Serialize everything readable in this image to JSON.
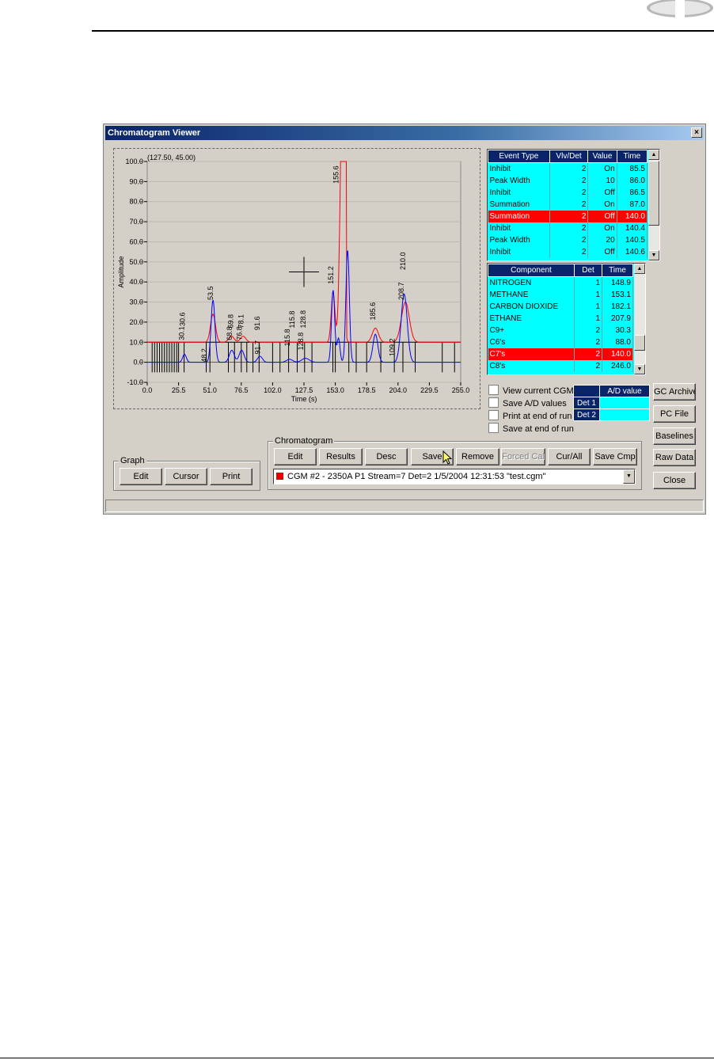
{
  "window": {
    "title": "Chromatogram Viewer",
    "close_glyph": "×"
  },
  "graph": {
    "cursor_readout": "(127.50, 45.00)",
    "xlabel": "Time (s)",
    "ylabel": "Amplitude",
    "y_ticks": [
      "100.0",
      "90.0",
      "80.0",
      "70.0",
      "60.0",
      "50.0",
      "40.0",
      "30.0",
      "20.0",
      "10.0",
      "0.0",
      "-10.0"
    ],
    "x_ticks": [
      "0.0",
      "25.5",
      "51.0",
      "76.5",
      "102.0",
      "127.5",
      "153.0",
      "178.5",
      "204.0",
      "229.5",
      "255.0"
    ],
    "peak_labels": [
      {
        "label": "53.5",
        "x": 53.5,
        "y": 31
      },
      {
        "label": "30.1",
        "x": 30.1,
        "y": 11
      },
      {
        "label": "30.6",
        "x": 30.6,
        "y": 18
      },
      {
        "label": "48.2",
        "x": 48.2,
        "y": 0
      },
      {
        "label": "68.8",
        "x": 68.8,
        "y": 11
      },
      {
        "label": "69.8",
        "x": 69.8,
        "y": 17
      },
      {
        "label": "76.8",
        "x": 76.8,
        "y": 11
      },
      {
        "label": "78.1",
        "x": 78.1,
        "y": 17
      },
      {
        "label": "91.7",
        "x": 91.7,
        "y": 4
      },
      {
        "label": "91.6",
        "x": 91.6,
        "y": 16
      },
      {
        "label": "115.8",
        "x": 115.8,
        "y": 8
      },
      {
        "label": "115.8",
        "x": 119.8,
        "y": 17
      },
      {
        "label": "128.8",
        "x": 128.8,
        "y": 17
      },
      {
        "label": "128.8",
        "x": 126.8,
        "y": 6
      },
      {
        "label": "151.2",
        "x": 151.2,
        "y": 39
      },
      {
        "label": "155.6",
        "x": 155.6,
        "y": 89
      },
      {
        "label": "185.6",
        "x": 185.6,
        "y": 21
      },
      {
        "label": "109.2",
        "x": 201.2,
        "y": 3
      },
      {
        "label": "208.7",
        "x": 208.7,
        "y": 31
      },
      {
        "label": "210.0",
        "x": 210.0,
        "y": 46
      }
    ]
  },
  "chart_data": {
    "type": "line",
    "xlabel": "Time (s)",
    "ylabel": "Amplitude",
    "xlim": [
      0,
      255
    ],
    "ylim": [
      -10,
      100
    ],
    "series": [
      {
        "color": "#ff0000",
        "baseline": 10,
        "peaks": [
          [
            53.5,
            14,
            2.0
          ],
          [
            68.5,
            3,
            2.2
          ],
          [
            78,
            3,
            2.2
          ],
          [
            151.2,
            25,
            1.5
          ],
          [
            158.0,
            90,
            1.6
          ],
          [
            185.6,
            7,
            2.5
          ],
          [
            210,
            20,
            3.2
          ]
        ],
        "flat_top": [
          [
            157,
            162,
            100
          ]
        ]
      },
      {
        "color": "#0000ff",
        "baseline": 0,
        "peaks": [
          [
            30.3,
            4,
            1.5
          ],
          [
            53.5,
            31,
            1.6
          ],
          [
            68.8,
            6,
            2.0
          ],
          [
            76.8,
            6,
            2.0
          ],
          [
            91.7,
            3,
            2.0
          ],
          [
            115.8,
            1.5,
            2.5
          ],
          [
            128.8,
            2,
            3
          ],
          [
            151.2,
            36,
            1.3
          ],
          [
            155.6,
            12,
            1.2
          ],
          [
            163,
            56,
            1.4
          ],
          [
            185.6,
            14,
            2.0
          ],
          [
            209,
            34,
            2.5
          ]
        ]
      }
    ],
    "cursor": {
      "x": 127.5,
      "y": 45.0
    }
  },
  "events_table": {
    "headers": [
      "Event Type",
      "Vlv/Det",
      "Value",
      "Time"
    ],
    "rows": [
      [
        "Inhibit",
        "2",
        "On",
        "85.5"
      ],
      [
        "Peak Width",
        "2",
        "10",
        "86.0"
      ],
      [
        "Inhibit",
        "2",
        "Off",
        "86.5"
      ],
      [
        "Summation",
        "2",
        "On",
        "87.0"
      ],
      [
        "Summation",
        "2",
        "Off",
        "140.0"
      ],
      [
        "Inhibit",
        "2",
        "On",
        "140.4"
      ],
      [
        "Peak Width",
        "2",
        "20",
        "140.5"
      ],
      [
        "Inhibit",
        "2",
        "Off",
        "140.6"
      ]
    ],
    "selected_index": 4
  },
  "component_table": {
    "headers": [
      "Component",
      "Det",
      "Time"
    ],
    "rows": [
      [
        "NITROGEN",
        "1",
        "148.9"
      ],
      [
        "METHANE",
        "1",
        "153.1"
      ],
      [
        "CARBON DIOXIDE",
        "1",
        "182.1"
      ],
      [
        "ETHANE",
        "1",
        "207.9"
      ],
      [
        "C9+",
        "2",
        "30.3"
      ],
      [
        "C6's",
        "2",
        "88.0"
      ],
      [
        "C7's",
        "2",
        "140.0"
      ],
      [
        "C8's",
        "2",
        "246.0"
      ]
    ],
    "selected_index": 6
  },
  "options": {
    "view_current_cgm": "View current CGM",
    "save_ad_values": "Save A/D values",
    "print_end_run": "Print at end of run",
    "save_end_run": "Save at end of run"
  },
  "ad_table": {
    "header": "A/D value",
    "det1": "Det 1",
    "det2": "Det 2"
  },
  "side_buttons": {
    "gc_archive": "GC Archive",
    "pc_file": "PC File",
    "baselines": "Baselines",
    "raw_data": "Raw Data",
    "close": "Close"
  },
  "graph_group": {
    "label": "Graph",
    "edit": "Edit",
    "cursor": "Cursor",
    "print": "Print"
  },
  "chromatogram_group": {
    "label": "Chromatogram",
    "edit": "Edit",
    "results": "Results",
    "desc": "Desc",
    "save": "Save",
    "remove": "Remove",
    "forced_cal": "Forced Cal",
    "cur_all": "Cur/All",
    "save_cmp": "Save Cmp",
    "selected_cgm": "CGM #2 - 2350A  P1 Stream=7 Det=2 1/5/2004 12:31:53 \"test.cgm\"",
    "swatch_color": "#e00000"
  }
}
